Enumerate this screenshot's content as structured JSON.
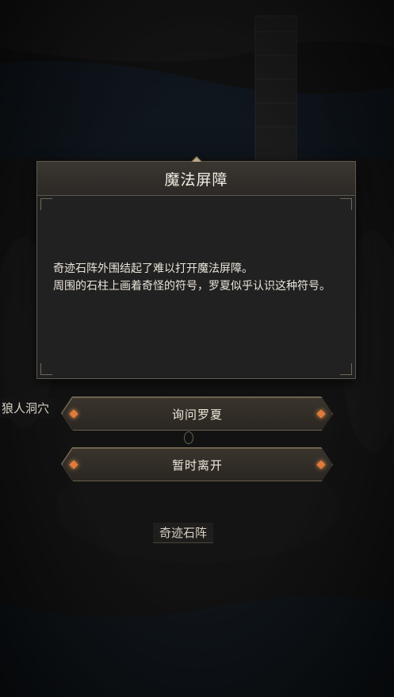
{
  "dialog": {
    "title": "魔法屏障",
    "lines": [
      "奇迹石阵外围结起了难以打开魔法屏障。",
      "周围的石柱上画着奇怪的符号，罗夏似乎认识这种符号。"
    ]
  },
  "choices": [
    {
      "label": "询问罗夏"
    },
    {
      "label": "暂时离开"
    }
  ],
  "locations": {
    "left": "狼人洞穴",
    "bottom": "奇迹石阵"
  },
  "colors": {
    "accent_gem": "#e07a3a",
    "panel_bg": "#222121",
    "border": "#5d574c"
  }
}
